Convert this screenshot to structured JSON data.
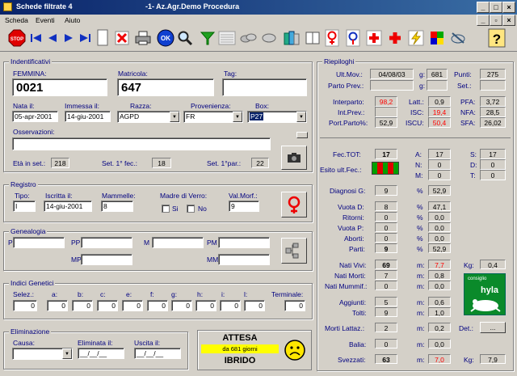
{
  "window": {
    "title_left": "Schede filtrate  4",
    "title_center": "-1-  Az.Agr.Demo Procedura"
  },
  "menu": [
    "Scheda",
    "Eventi",
    "Aiuto"
  ],
  "toolbar": {
    "stop": "STOP",
    "ok": "OK",
    "help": "?"
  },
  "identificativi": {
    "title": "Indentificativi",
    "femmina_label": "FEMMINA:",
    "femmina": "0021",
    "matricola_label": "Matricola:",
    "matricola": "647",
    "tag_label": "Tag:",
    "tag": "",
    "nata_label": "Nata il:",
    "nata": "05-apr-2001",
    "immessa_label": "Immessa il:",
    "immessa": "14-giu-2001",
    "razza_label": "Razza:",
    "razza": "AGPD",
    "provenienza_label": "Provenienza:",
    "provenienza": "FR",
    "box_label": "Box:",
    "box": "P27",
    "osservazioni_label": "Osservazioni:",
    "osservazioni": "",
    "eta_label": "Età in set.:",
    "eta": "218",
    "set1fec_label": "Set. 1° fec.:",
    "set1fec": "18",
    "set1par_label": "Set. 1°par.:",
    "set1par": "22"
  },
  "registro": {
    "title": "Registro",
    "tipo_label": "Tipo:",
    "tipo": "I",
    "iscritta_label": "Iscritta il:",
    "iscritta": "14-giu-2001",
    "mammelle_label": "Mammelle:",
    "mammelle": "8",
    "madre_label": "Madre di Verro:",
    "si": "Si",
    "no": "No",
    "valmorf_label": "Val.Morf.:",
    "valmorf": "9"
  },
  "genealogia": {
    "title": "Genealogia",
    "p": "P",
    "pp": "PP",
    "m": "M",
    "pm": "PM",
    "mp": "MP",
    "mm": "MM"
  },
  "indici": {
    "title": "Indici Genetici",
    "selez_label": "Selez.:",
    "cols": [
      "a:",
      "b:",
      "c:",
      "e:",
      "f:",
      "g:",
      "h:",
      "i:",
      "l:"
    ],
    "terminale_label": "Terminale:",
    "values": [
      "0",
      "0",
      "0",
      "0",
      "0",
      "0",
      "0",
      "0",
      "0",
      "0",
      "0"
    ]
  },
  "eliminazione": {
    "title": "Eliminazione",
    "causa_label": "Causa:",
    "eliminata_label": "Eliminata il:",
    "eliminata": "__/__/__",
    "uscita_label": "Uscita il:",
    "uscita": "__/__/__"
  },
  "status": {
    "attesa": "ATTESA",
    "giorni": "da 681 giorni",
    "ibrido": "IBRIDO"
  },
  "riepiloghi": {
    "title": "Riepiloghi",
    "ultmov_label": "Ult.Mov.:",
    "ultmov": "04/08/03",
    "g_label": "g:",
    "g": "681",
    "punti_label": "Punti:",
    "punti": "275",
    "partoprev_label": "Parto Prev.:",
    "g2_label": "g:",
    "set_label": "Set.:",
    "interparto_label": "Interparto:",
    "interparto": "98,2",
    "intprev_label": "Int.Prev.:",
    "portparto_label": "Port.Parto%:",
    "portparto": "52,9",
    "latt_label": "Latt.:",
    "latt": "0,9",
    "isc_label": "ISC:",
    "isc": "19,4",
    "iscu_label": "ISCU:",
    "iscu": "50,4",
    "pfa_label": "PFA:",
    "pfa": "3,72",
    "nfa_label": "NFA:",
    "nfa": "28,5",
    "sfa_label": "SFA:",
    "sfa": "26,02",
    "fectot_label": "Fec.TOT:",
    "fectot": "17",
    "esito_label": "Esito ult.Fec.:",
    "a_label": "A:",
    "a": "17",
    "n_label": "N:",
    "n": "0",
    "mm_label": "M:",
    "mm": "0",
    "s_label": "S:",
    "s": "17",
    "d_label": "D:",
    "d": "0",
    "t_label": "T:",
    "t": "0",
    "diagnosi_label": "Diagnosi G:",
    "diagnosi": "9",
    "pct": "%",
    "diagnosi_pct": "52,9",
    "vuotad_label": "Vuota D:",
    "vuotad": "8",
    "vuotad_pct": "47,1",
    "ritorni_label": "Ritorni:",
    "ritorni": "0",
    "ritorni_pct": "0,0",
    "vuotap_label": "Vuota P:",
    "vuotap": "0",
    "vuotap_pct": "0,0",
    "aborti_label": "Aborti:",
    "aborti": "0",
    "aborti_pct": "0,0",
    "parti_label": "Parti:",
    "parti": "9",
    "parti_pct": "52,9",
    "nativivi_label": "Nati Vivi:",
    "nativivi": "69",
    "m_label": "m:",
    "nativivi_m": "7,7",
    "kg_label": "Kg:",
    "nativivi_kg": "0,4",
    "natimorti_label": "Nati Morti:",
    "natimorti": "7",
    "natimorti_m": "0,8",
    "natimumm_label": "Nati Mummif.:",
    "natimumm": "0",
    "natimumm_m": "0,0",
    "aggiunti_label": "Aggiunti:",
    "aggiunti": "5",
    "aggiunti_m": "0,6",
    "tolti_label": "Tolti:",
    "tolti": "9",
    "tolti_m": "1,0",
    "mortilatt_label": "Morti Lattaz.:",
    "mortilatt": "2",
    "mortilatt_m": "0,2",
    "det_label": "Det.:",
    "det_btn": "...",
    "balia_label": "Balia:",
    "balia": "0",
    "balia_m": "0,0",
    "svezzati_label": "Svezzati:",
    "svezzati": "63",
    "svezzati_m": "7,0",
    "svezzati_kg": "7,9",
    "logo_small": "consiglio",
    "logo": "hyla"
  }
}
